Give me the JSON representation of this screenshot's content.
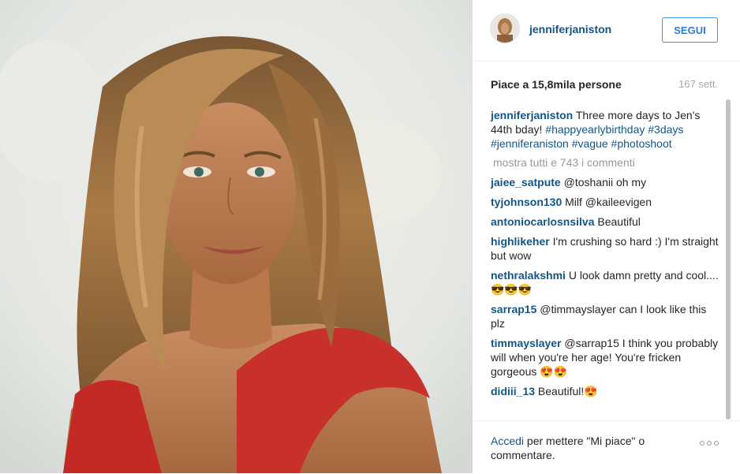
{
  "post": {
    "username": "jenniferjaniston",
    "follow_label": "SEGUI",
    "likes": "Piace a 15,8mila persone",
    "time": "167 sett."
  },
  "caption": {
    "user": "jenniferjaniston",
    "text": "Three more days to Jen's 44th bday! ",
    "hashtags": "#happyearlybirthday #3days #jenniferaniston #vague #photoshoot"
  },
  "show_all_comments": "mostra tutti e 743 i commenti",
  "comments": [
    {
      "user": "jaiee_satpute",
      "text": "@toshanii oh my"
    },
    {
      "user": "tyjohnson130",
      "text": "Milf @kaileevigen"
    },
    {
      "user": "antoniocarlosnsilva",
      "text": "Beautiful"
    },
    {
      "user": "highlikeher",
      "text": "I'm crushing so hard :) I'm straight but wow"
    },
    {
      "user": "nethralakshmi",
      "text": "U look damn pretty and cool....😎😎😎"
    },
    {
      "user": "sarrap15",
      "text": "@timmayslayer can I look like this plz"
    },
    {
      "user": "timmayslayer",
      "text": "@sarrap15 I think you probably will when you're her age! You're fricken gorgeous 😍😍"
    },
    {
      "user": "didiii_13",
      "text": "Beautiful!😍"
    }
  ],
  "footer": {
    "login_link": "Accedi",
    "login_text": " per mettere \"Mi piace\" o commentare."
  }
}
